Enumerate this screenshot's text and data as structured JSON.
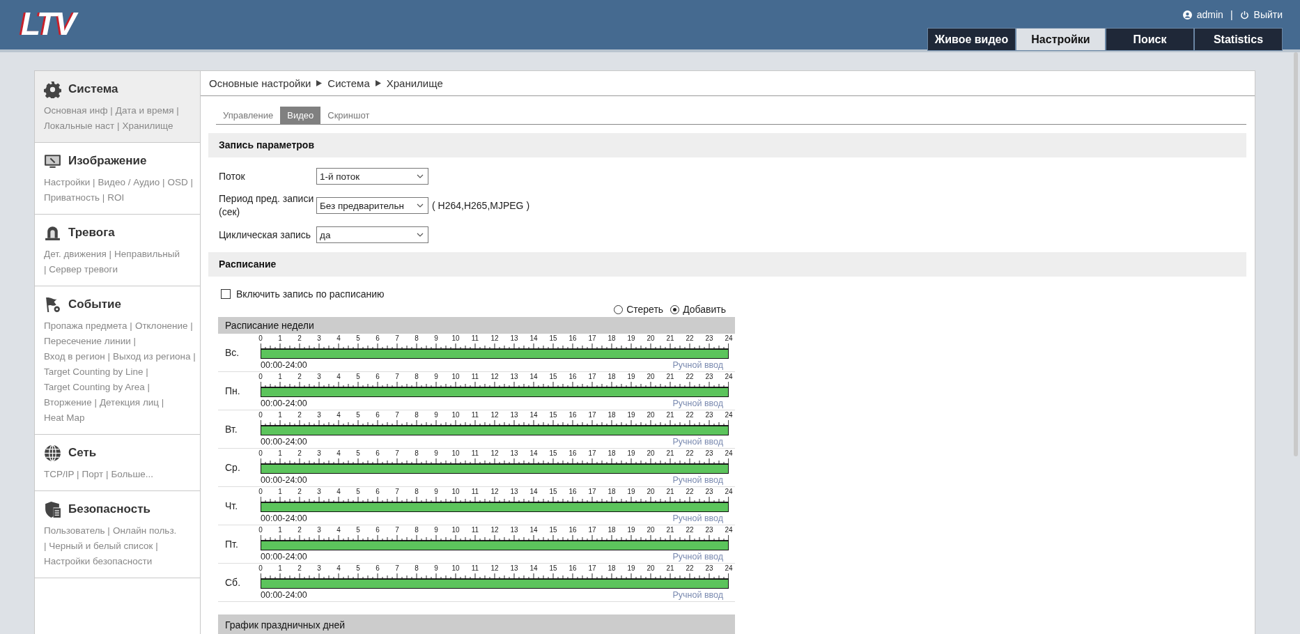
{
  "header": {
    "logo": "LTV",
    "user": "admin",
    "separator": "|",
    "logout": "Выйти",
    "tabs": [
      {
        "label": "Живое видео",
        "selected": false
      },
      {
        "label": "Настройки",
        "selected": true
      },
      {
        "label": "Поиск",
        "selected": false
      },
      {
        "label": "Statistics",
        "selected": false
      }
    ]
  },
  "sidebar": {
    "sections": [
      {
        "kind": "gear",
        "title": "Система",
        "selected": true,
        "links": [
          "Основная инф |",
          "Дата и время |",
          "Локальные наст |",
          "Хранилище"
        ]
      },
      {
        "kind": "monitor",
        "title": "Изображение",
        "selected": false,
        "links": [
          "Настройки |",
          "Видео / Аудио |",
          "OSD |",
          "Приватность |",
          "ROI"
        ]
      },
      {
        "kind": "alarm",
        "title": "Тревога",
        "selected": false,
        "links": [
          "Дет. движения |",
          "Неправильный",
          "| Сервер тревоги"
        ]
      },
      {
        "kind": "flag",
        "title": "Событие",
        "selected": false,
        "links": [
          "Пропажа предмета |",
          "Отклонение |",
          "Пересечение линии |",
          "Вход в регион |",
          "Выход из региона |",
          "Target Counting by Line |",
          "Target Counting by Area |",
          "Вторжение |",
          "Детекция лиц |",
          "Heat Map"
        ]
      },
      {
        "kind": "globe",
        "title": "Сеть",
        "selected": false,
        "links": [
          "TCP/IP |",
          "Порт |",
          "Больше..."
        ]
      },
      {
        "kind": "shield",
        "title": "Безопасность",
        "selected": false,
        "links": [
          "Пользователь |",
          "Онлайн польз.",
          "| Черный и белый список |",
          "Настройки безопасности"
        ]
      }
    ]
  },
  "breadcrumb": [
    "Основные настройки",
    "Система",
    "Хранилище"
  ],
  "subtabs": [
    {
      "label": "Управление",
      "selected": false
    },
    {
      "label": "Видео",
      "selected": true
    },
    {
      "label": "Скриншот",
      "selected": false
    }
  ],
  "record_params": {
    "title": "Запись параметров",
    "fields": [
      {
        "label": "Поток",
        "value": "1-й поток"
      },
      {
        "label": "Период пред. записи (сек)",
        "value": "Без предварительн",
        "note": "( H264,H265,MJPEG )"
      },
      {
        "label": "Циклическая запись",
        "value": "да"
      }
    ]
  },
  "schedule": {
    "title": "Расписание",
    "enable_label": "Включить запись по расписанию",
    "enabled": false,
    "modes": [
      {
        "label": "Стереть",
        "selected": false
      },
      {
        "label": "Добавить",
        "selected": true
      }
    ],
    "week_title": "Расписание недели",
    "days": [
      {
        "day": "Вс.",
        "hours": [
          "0",
          "1",
          "2",
          "3",
          "4",
          "5",
          "6",
          "7",
          "8",
          "9",
          "10",
          "11",
          "12",
          "13",
          "14",
          "15",
          "16",
          "17",
          "18",
          "19",
          "20",
          "21",
          "22",
          "23",
          "24"
        ],
        "level": 1,
        "range": "00:00-24:00",
        "manual": "Ручной ввод"
      },
      {
        "day": "Пн.",
        "hours": [
          "0",
          "1",
          "2",
          "3",
          "4",
          "5",
          "6",
          "7",
          "8",
          "9",
          "10",
          "11",
          "12",
          "13",
          "14",
          "15",
          "16",
          "17",
          "18",
          "19",
          "20",
          "21",
          "22",
          "23",
          "24"
        ],
        "level": 1,
        "range": "00:00-24:00",
        "manual": "Ручной ввод"
      },
      {
        "day": "Вт.",
        "hours": [
          "0",
          "1",
          "2",
          "3",
          "4",
          "5",
          "6",
          "7",
          "8",
          "9",
          "10",
          "11",
          "12",
          "13",
          "14",
          "15",
          "16",
          "17",
          "18",
          "19",
          "20",
          "21",
          "22",
          "23",
          "24"
        ],
        "level": 1,
        "range": "00:00-24:00",
        "manual": "Ручной ввод"
      },
      {
        "day": "Ср.",
        "hours": [
          "0",
          "1",
          "2",
          "3",
          "4",
          "5",
          "6",
          "7",
          "8",
          "9",
          "10",
          "11",
          "12",
          "13",
          "14",
          "15",
          "16",
          "17",
          "18",
          "19",
          "20",
          "21",
          "22",
          "23",
          "24"
        ],
        "level": 1,
        "range": "00:00-24:00",
        "manual": "Ручной ввод"
      },
      {
        "day": "Чт.",
        "hours": [
          "0",
          "1",
          "2",
          "3",
          "4",
          "5",
          "6",
          "7",
          "8",
          "9",
          "10",
          "11",
          "12",
          "13",
          "14",
          "15",
          "16",
          "17",
          "18",
          "19",
          "20",
          "21",
          "22",
          "23",
          "24"
        ],
        "level": 1,
        "range": "00:00-24:00",
        "manual": "Ручной ввод"
      },
      {
        "day": "Пт.",
        "hours": [
          "0",
          "1",
          "2",
          "3",
          "4",
          "5",
          "6",
          "7",
          "8",
          "9",
          "10",
          "11",
          "12",
          "13",
          "14",
          "15",
          "16",
          "17",
          "18",
          "19",
          "20",
          "21",
          "22",
          "23",
          "24"
        ],
        "level": 1,
        "range": "00:00-24:00",
        "manual": "Ручной ввод"
      },
      {
        "day": "Сб.",
        "hours": [
          "0",
          "1",
          "2",
          "3",
          "4",
          "5",
          "6",
          "7",
          "8",
          "9",
          "10",
          "11",
          "12",
          "13",
          "14",
          "15",
          "16",
          "17",
          "18",
          "19",
          "20",
          "21",
          "22",
          "23",
          "24"
        ],
        "level": 1,
        "range": "00:00-24:00",
        "manual": "Ручной ввод"
      }
    ],
    "holiday_title": "График праздничных дней"
  }
}
